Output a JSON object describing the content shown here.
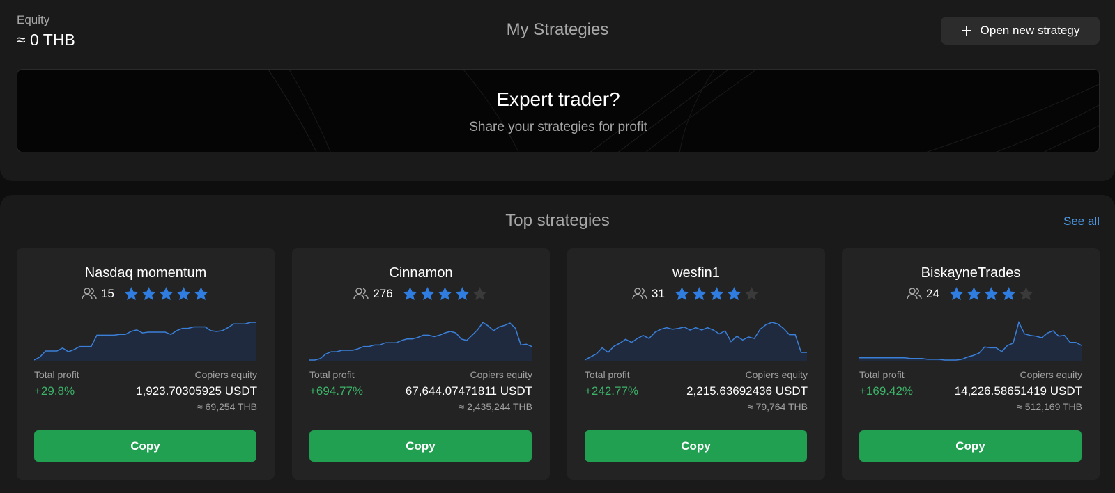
{
  "header": {
    "equity_label": "Equity",
    "equity_value": "≈ 0 THB",
    "title": "My Strategies",
    "open_button_label": "Open new strategy"
  },
  "banner": {
    "title": "Expert trader?",
    "subtitle": "Share your strategies for profit"
  },
  "top": {
    "title": "Top strategies",
    "see_all": "See all"
  },
  "colors": {
    "accent_blue": "#2f7de1",
    "star_off": "#3a3a3a",
    "profit_green": "#3cb368",
    "button_green": "#20a050",
    "spark_fill": "#1f2a3e",
    "spark_line": "#3a7fd8"
  },
  "cards": [
    {
      "name": "Nasdaq momentum",
      "copiers": "15",
      "rating": 5,
      "profit_label": "Total profit",
      "profit": "+29.8%",
      "equity_label": "Copiers equity",
      "equity": "1,923.70305925 USDT",
      "equity_approx": "≈ 69,254 THB",
      "button": "Copy",
      "spark": [
        2,
        6,
        14,
        14,
        14,
        18,
        13,
        16,
        20,
        20,
        20,
        35,
        35,
        35,
        35,
        36,
        36,
        40,
        42,
        38,
        39,
        39,
        39,
        39,
        36,
        41,
        44,
        44,
        46,
        46,
        46,
        41,
        40,
        41,
        45,
        50,
        50,
        50,
        52,
        52
      ]
    },
    {
      "name": "Cinnamon",
      "copiers": "276",
      "rating": 4,
      "profit_label": "Total profit",
      "profit": "+694.77%",
      "equity_label": "Copiers equity",
      "equity": "67,644.07471811 USDT",
      "equity_approx": "≈ 2,435,244 THB",
      "button": "Copy",
      "spark": [
        2,
        2,
        4,
        10,
        13,
        13,
        15,
        15,
        15,
        17,
        20,
        20,
        22,
        22,
        25,
        25,
        25,
        28,
        30,
        30,
        32,
        35,
        35,
        33,
        35,
        38,
        40,
        38,
        30,
        28,
        35,
        42,
        52,
        47,
        41,
        46,
        48,
        51,
        44,
        22,
        23,
        20
      ]
    },
    {
      "name": "wesfin1",
      "copiers": "31",
      "rating": 4,
      "profit_label": "Total profit",
      "profit": "+242.77%",
      "equity_label": "Copiers equity",
      "equity": "2,215.63692436 USDT",
      "equity_approx": "≈ 79,764 THB",
      "button": "Copy",
      "spark": [
        2,
        6,
        10,
        18,
        12,
        20,
        24,
        29,
        25,
        30,
        34,
        30,
        38,
        42,
        44,
        42,
        43,
        45,
        41,
        44,
        41,
        44,
        41,
        36,
        40,
        26,
        33,
        28,
        32,
        30,
        42,
        48,
        51,
        49,
        43,
        35,
        35,
        12,
        12
      ]
    },
    {
      "name": "BiskayneTrades",
      "copiers": "24",
      "rating": 4,
      "profit_label": "Total profit",
      "profit": "+169.42%",
      "equity_label": "Copiers equity",
      "equity": "14,226.58651419 USDT",
      "equity_approx": "≈ 512,169 THB",
      "button": "Copy",
      "spark": [
        2,
        2,
        2,
        2,
        2,
        2,
        2,
        2,
        2,
        1,
        1,
        1,
        0,
        0,
        0,
        -1,
        -1,
        -1,
        0,
        3,
        5,
        8,
        16,
        15,
        15,
        10,
        18,
        21,
        48,
        33,
        31,
        30,
        28,
        34,
        37,
        30,
        31,
        22,
        22,
        18
      ]
    }
  ]
}
